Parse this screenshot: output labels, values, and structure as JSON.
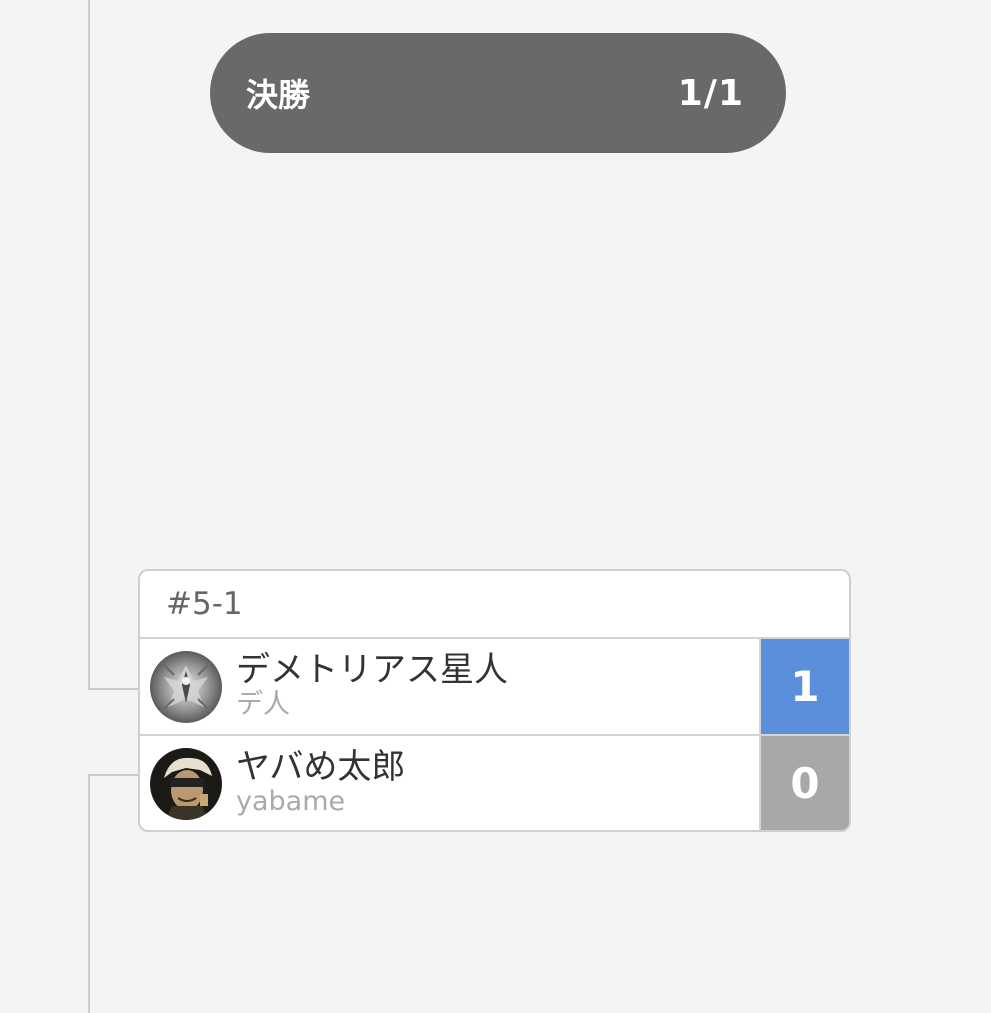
{
  "round": {
    "title": "決勝",
    "count": "1/1",
    "pill_color": "#696969"
  },
  "match": {
    "id": "#5-1",
    "players": [
      {
        "name": "デメトリアス星人",
        "sub": "デ人",
        "score": "1",
        "score_color": "#5b8fdb",
        "avatar_icon": "monochrome-creature-avatar-icon",
        "winner": true
      },
      {
        "name": "ヤバめ太郎",
        "sub": "yabame",
        "score": "0",
        "score_color": "#a8a8a8",
        "avatar_icon": "anime-character-avatar-icon",
        "winner": false
      }
    ]
  },
  "colors": {
    "background": "#f4f4f4",
    "connector": "#cccccc",
    "card_border": "#cfcfcf"
  }
}
